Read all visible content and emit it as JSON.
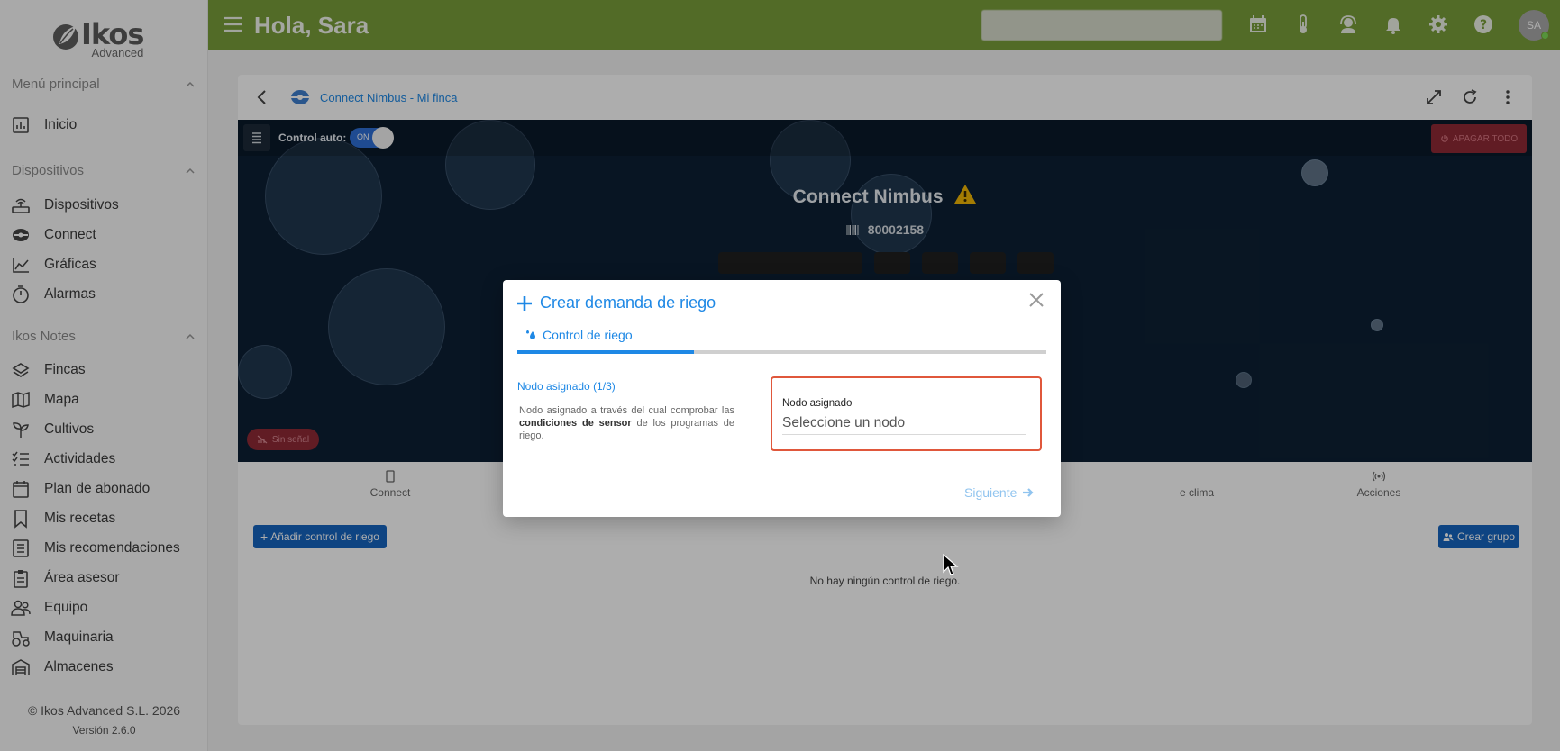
{
  "app": {
    "logo_main": "Ikos",
    "logo_sub": "Advanced",
    "greeting": "Hola, Sara",
    "avatar_initials": "SA",
    "brand_color": "#7a9e3a"
  },
  "sidebar": {
    "sections": [
      {
        "label": "Menú principal"
      },
      {
        "label": "Dispositivos"
      },
      {
        "label": "Ikos Notes"
      }
    ],
    "items": [
      {
        "label": "Inicio",
        "icon": "dashboard-icon"
      },
      {
        "label": "Dispositivos",
        "icon": "router-icon"
      },
      {
        "label": "Connect",
        "icon": "connect-icon"
      },
      {
        "label": "Gráficas",
        "icon": "chart-icon"
      },
      {
        "label": "Alarmas",
        "icon": "timer-icon"
      },
      {
        "label": "Fincas",
        "icon": "layers-icon"
      },
      {
        "label": "Mapa",
        "icon": "map-icon"
      },
      {
        "label": "Cultivos",
        "icon": "sprout-icon"
      },
      {
        "label": "Actividades",
        "icon": "checklist-icon"
      },
      {
        "label": "Plan de abonado",
        "icon": "calendar-icon"
      },
      {
        "label": "Mis recetas",
        "icon": "bookmark-icon"
      },
      {
        "label": "Mis recomendaciones",
        "icon": "document-list-icon"
      },
      {
        "label": "Área asesor",
        "icon": "clipboard-icon"
      },
      {
        "label": "Equipo",
        "icon": "users-icon"
      },
      {
        "label": "Maquinaria",
        "icon": "tractor-icon"
      },
      {
        "label": "Almacenes",
        "icon": "warehouse-icon"
      }
    ],
    "copyright": "© Ikos Advanced S.L. 2026",
    "version": "Versión 2.6.0"
  },
  "card": {
    "breadcrumb": "Connect Nimbus - Mi finca",
    "control_auto_label": "Control auto:",
    "toggle_label": "ON",
    "off_all_label": "APAGAR TODO",
    "device_name": "Connect Nimbus",
    "serial": "80002158",
    "no_signal": "Sin señal",
    "tabs": [
      {
        "label": "Connect"
      },
      {
        "label": "e clima"
      },
      {
        "label": "Acciones"
      }
    ],
    "add_control_label": "Añadir control de riego",
    "create_group_label": "Crear grupo",
    "empty_text": "No hay ningún control de riego."
  },
  "modal": {
    "title": "Crear demanda de riego",
    "tab_label": "Control de riego",
    "progress_fraction": 0.3333,
    "step_title": "Nodo asignado (1/3)",
    "desc_part1": "Nodo asignado a través del cual comprobar las ",
    "desc_bold": "condiciones de sensor",
    "desc_part2": " de los programas de riego.",
    "field_label": "Nodo asignado",
    "field_placeholder": "Seleccione un nodo",
    "next_label": "Siguiente"
  }
}
